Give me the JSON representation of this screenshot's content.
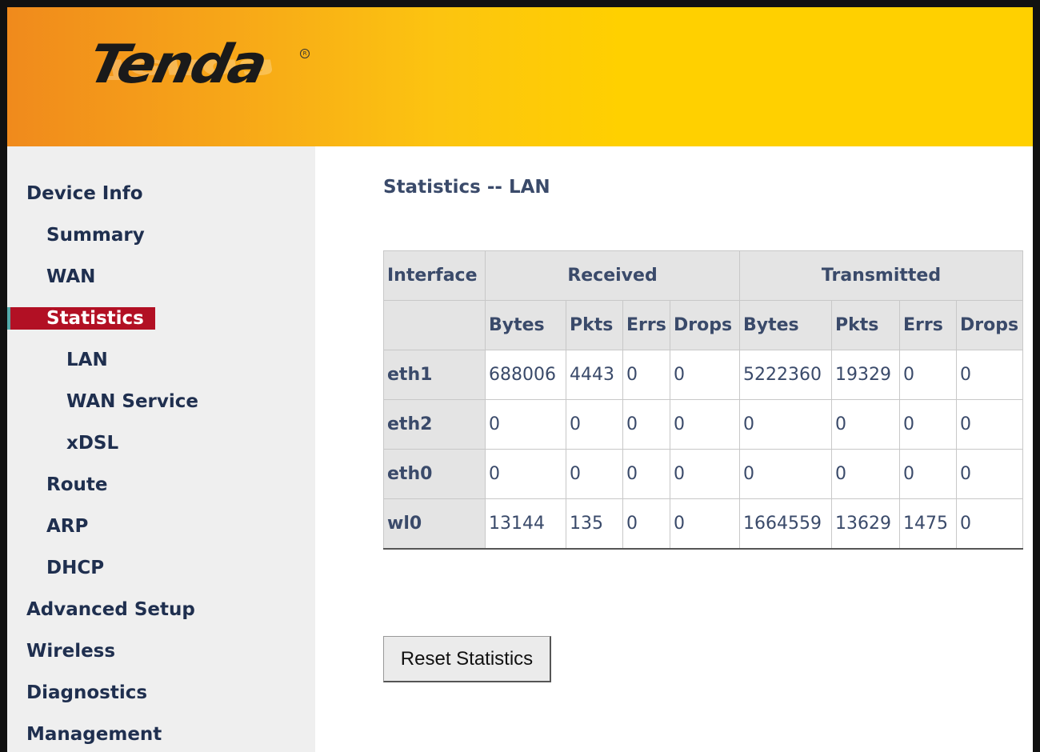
{
  "header": {
    "brand": "Tenda",
    "registered_mark": "R",
    "brand_colors": {
      "left": "#f08a1c",
      "right": "#ffd000"
    }
  },
  "sidebar": {
    "items": [
      {
        "label": "Device Info",
        "level": 0,
        "active": false
      },
      {
        "label": "Summary",
        "level": 1,
        "active": false
      },
      {
        "label": "WAN",
        "level": 1,
        "active": false
      },
      {
        "label": "Statistics",
        "level": 1,
        "active": true
      },
      {
        "label": "LAN",
        "level": 2,
        "active": false
      },
      {
        "label": "WAN Service",
        "level": 2,
        "active": false
      },
      {
        "label": "xDSL",
        "level": 2,
        "active": false
      },
      {
        "label": "Route",
        "level": 1,
        "active": false
      },
      {
        "label": "ARP",
        "level": 1,
        "active": false
      },
      {
        "label": "DHCP",
        "level": 1,
        "active": false
      },
      {
        "label": "Advanced Setup",
        "level": 0,
        "active": false
      },
      {
        "label": "Wireless",
        "level": 0,
        "active": false
      },
      {
        "label": "Diagnostics",
        "level": 0,
        "active": false
      },
      {
        "label": "Management",
        "level": 0,
        "active": false
      }
    ],
    "active_color": "#b21024"
  },
  "main": {
    "title": "Statistics -- LAN",
    "table": {
      "header_interface": "Interface",
      "header_received": "Received",
      "header_transmitted": "Transmitted",
      "subheaders": [
        "Bytes",
        "Pkts",
        "Errs",
        "Drops",
        "Bytes",
        "Pkts",
        "Errs",
        "Drops"
      ],
      "rows": [
        {
          "name": "eth1",
          "values": [
            "688006",
            "4443",
            "0",
            "0",
            "5222360",
            "19329",
            "0",
            "0"
          ]
        },
        {
          "name": "eth2",
          "values": [
            "0",
            "0",
            "0",
            "0",
            "0",
            "0",
            "0",
            "0"
          ]
        },
        {
          "name": "eth0",
          "values": [
            "0",
            "0",
            "0",
            "0",
            "0",
            "0",
            "0",
            "0"
          ]
        },
        {
          "name": "wl0",
          "values": [
            "13144",
            "135",
            "0",
            "0",
            "1664559",
            "13629",
            "1475",
            "0"
          ]
        }
      ]
    },
    "reset_button": "Reset Statistics"
  }
}
